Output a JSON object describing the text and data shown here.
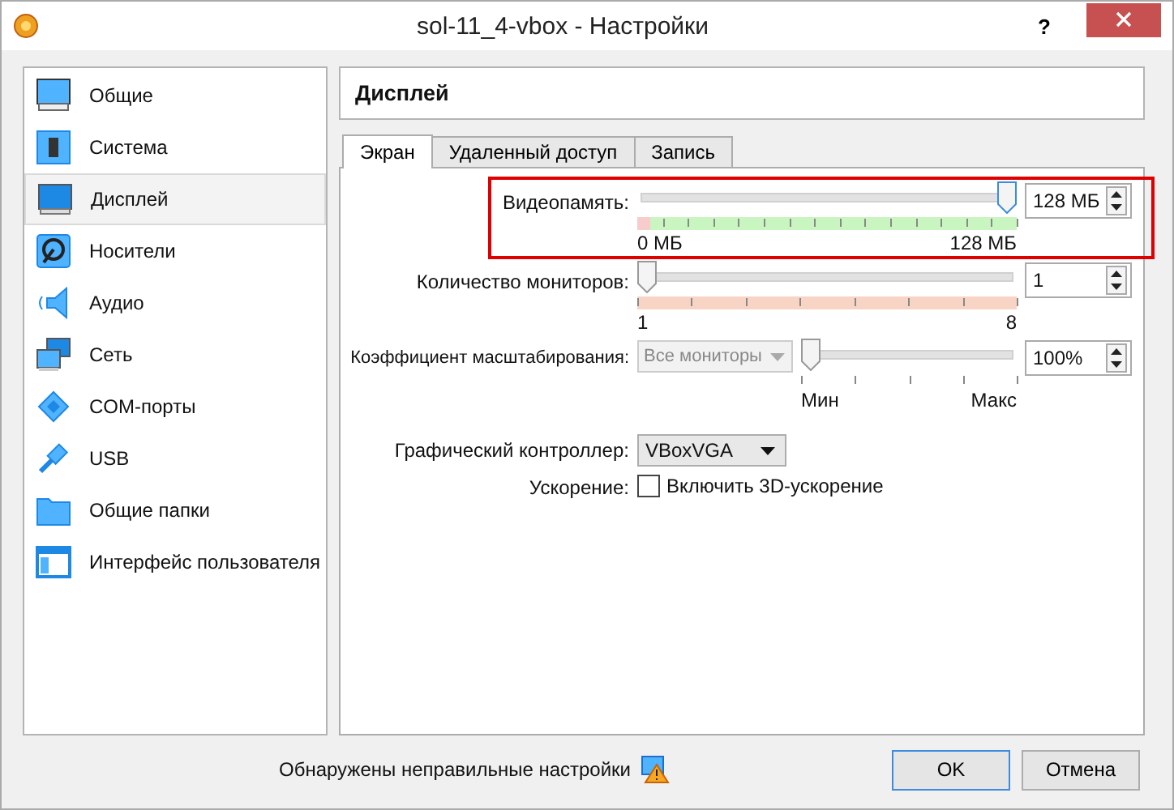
{
  "window": {
    "title": "sol-11_4-vbox - Настройки",
    "help": "?"
  },
  "sidebar": {
    "items": [
      {
        "label": "Общие",
        "kind": "general",
        "selected": false
      },
      {
        "label": "Система",
        "kind": "system",
        "selected": false
      },
      {
        "label": "Дисплей",
        "kind": "display",
        "selected": true
      },
      {
        "label": "Носители",
        "kind": "storage",
        "selected": false
      },
      {
        "label": "Аудио",
        "kind": "audio",
        "selected": false
      },
      {
        "label": "Сеть",
        "kind": "network",
        "selected": false
      },
      {
        "label": "COM-порты",
        "kind": "serial",
        "selected": false
      },
      {
        "label": "USB",
        "kind": "usb",
        "selected": false
      },
      {
        "label": "Общие папки",
        "kind": "folder",
        "selected": false
      },
      {
        "label": "Интерфейс пользователя",
        "kind": "ui",
        "selected": false
      }
    ]
  },
  "page": {
    "title": "Дисплей",
    "tabs": [
      {
        "label": "Экран",
        "selected": true
      },
      {
        "label": "Удаленный доступ",
        "selected": false
      },
      {
        "label": "Запись",
        "selected": false
      }
    ],
    "settings": [
      {
        "kind": "slider",
        "label": "Видеопамять:",
        "level": 1,
        "value": "128 МБ",
        "min_label": "0 МБ",
        "max_label": "128 МБ",
        "color": "#c8f5c0",
        "low_zone": true,
        "highlighted": true
      },
      {
        "kind": "slider",
        "label": "Количество мониторов:",
        "level": 0,
        "value": "1",
        "min_label": "1",
        "max_label": "8",
        "color": "#f8d4c4",
        "low_zone": false,
        "highlighted": false
      },
      {
        "kind": "combo-slider",
        "label": "Коэффициент масштабирования:",
        "combo": "Все мониторы",
        "disabled": true,
        "level": 0,
        "value": "100%",
        "min_label": "Мин",
        "max_label": "Макс",
        "highlighted": false
      },
      {
        "kind": "dropdown",
        "label": "Графический контроллер:",
        "value": "VBoxVGA"
      },
      {
        "kind": "checkbox",
        "label": "Ускорение:",
        "text": "Включить 3D-ускорение",
        "checked": false
      }
    ]
  },
  "footer": {
    "warning": "Обнаружены неправильные настройки",
    "buttons": [
      {
        "label": "OK",
        "default": true
      },
      {
        "label": "Отмена",
        "default": false
      }
    ]
  }
}
